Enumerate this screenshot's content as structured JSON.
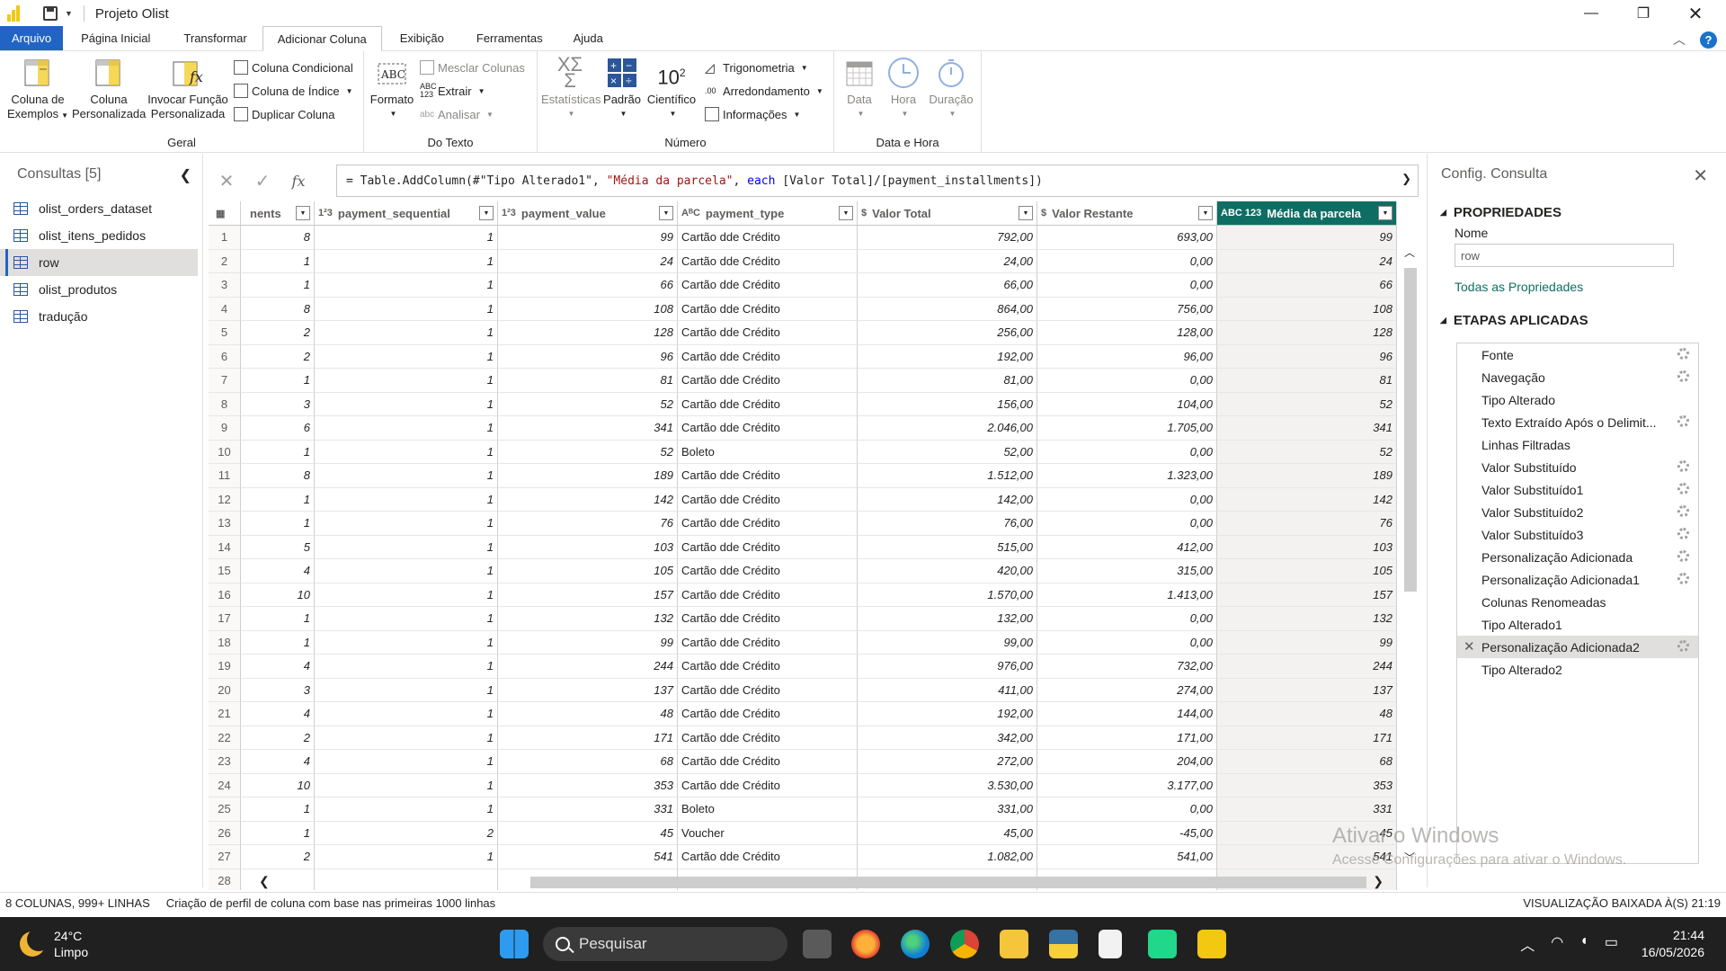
{
  "window": {
    "title": "Projeto Olist"
  },
  "tabs": [
    "Arquivo",
    "Página Inicial",
    "Transformar",
    "Adicionar Coluna",
    "Exibição",
    "Ferramentas",
    "Ajuda"
  ],
  "ribbon": {
    "geral": {
      "label": "Geral",
      "coluna_exemplos": [
        "Coluna de",
        "Exemplos"
      ],
      "coluna_personalizada": [
        "Coluna",
        "Personalizada"
      ],
      "invocar_funcao": [
        "Invocar Função",
        "Personalizada"
      ],
      "coluna_condicional": "Coluna Condicional",
      "coluna_indice": "Coluna de Índice",
      "duplicar_coluna": "Duplicar Coluna"
    },
    "texto": {
      "label": "Do Texto",
      "formato": "Formato",
      "mesclar": "Mesclar Colunas",
      "extrair": "Extrair",
      "analisar": "Analisar"
    },
    "numero": {
      "label": "Número",
      "estatisticas": "Estatísticas",
      "padrao": "Padrão",
      "cientifico": "Científico",
      "trigonometria": "Trigonometria",
      "arredondamento": "Arredondamento",
      "informacoes": "Informações"
    },
    "datahora": {
      "label": "Data e Hora",
      "data": "Data",
      "hora": "Hora",
      "duracao": "Duração"
    }
  },
  "queries": {
    "title": "Consultas [5]",
    "items": [
      "olist_orders_dataset",
      "olist_itens_pedidos",
      "row",
      "olist_produtos",
      "tradução"
    ],
    "selected": "row"
  },
  "formula": {
    "prefix": "= Table.AddColumn(#\"Tipo Alterado1\", ",
    "str": "\"Média da parcela\"",
    "mid": ", ",
    "kw": "each",
    "suffix": " [Valor Total]/[payment_installments])"
  },
  "grid": {
    "columns": [
      {
        "name": "nents",
        "type": ""
      },
      {
        "name": "payment_sequential",
        "type": "1²3"
      },
      {
        "name": "payment_value",
        "type": "1²3"
      },
      {
        "name": "payment_type",
        "type": "AᴮC"
      },
      {
        "name": "Valor Total",
        "type": "$"
      },
      {
        "name": "Valor Restante",
        "type": "$"
      },
      {
        "name": "Média da parcela",
        "type": "ABC 123"
      }
    ],
    "rows": [
      [
        "1",
        "8",
        "1",
        "99",
        "Cartão dde Crédito",
        "792,00",
        "693,00",
        "99"
      ],
      [
        "2",
        "1",
        "1",
        "24",
        "Cartão dde Crédito",
        "24,00",
        "0,00",
        "24"
      ],
      [
        "3",
        "1",
        "1",
        "66",
        "Cartão dde Crédito",
        "66,00",
        "0,00",
        "66"
      ],
      [
        "4",
        "8",
        "1",
        "108",
        "Cartão dde Crédito",
        "864,00",
        "756,00",
        "108"
      ],
      [
        "5",
        "2",
        "1",
        "128",
        "Cartão dde Crédito",
        "256,00",
        "128,00",
        "128"
      ],
      [
        "6",
        "2",
        "1",
        "96",
        "Cartão dde Crédito",
        "192,00",
        "96,00",
        "96"
      ],
      [
        "7",
        "1",
        "1",
        "81",
        "Cartão dde Crédito",
        "81,00",
        "0,00",
        "81"
      ],
      [
        "8",
        "3",
        "1",
        "52",
        "Cartão dde Crédito",
        "156,00",
        "104,00",
        "52"
      ],
      [
        "9",
        "6",
        "1",
        "341",
        "Cartão dde Crédito",
        "2.046,00",
        "1.705,00",
        "341"
      ],
      [
        "10",
        "1",
        "1",
        "52",
        "Boleto",
        "52,00",
        "0,00",
        "52"
      ],
      [
        "11",
        "8",
        "1",
        "189",
        "Cartão dde Crédito",
        "1.512,00",
        "1.323,00",
        "189"
      ],
      [
        "12",
        "1",
        "1",
        "142",
        "Cartão dde Crédito",
        "142,00",
        "0,00",
        "142"
      ],
      [
        "13",
        "1",
        "1",
        "76",
        "Cartão dde Crédito",
        "76,00",
        "0,00",
        "76"
      ],
      [
        "14",
        "5",
        "1",
        "103",
        "Cartão dde Crédito",
        "515,00",
        "412,00",
        "103"
      ],
      [
        "15",
        "4",
        "1",
        "105",
        "Cartão dde Crédito",
        "420,00",
        "315,00",
        "105"
      ],
      [
        "16",
        "10",
        "1",
        "157",
        "Cartão dde Crédito",
        "1.570,00",
        "1.413,00",
        "157"
      ],
      [
        "17",
        "1",
        "1",
        "132",
        "Cartão dde Crédito",
        "132,00",
        "0,00",
        "132"
      ],
      [
        "18",
        "1",
        "1",
        "99",
        "Cartão dde Crédito",
        "99,00",
        "0,00",
        "99"
      ],
      [
        "19",
        "4",
        "1",
        "244",
        "Cartão dde Crédito",
        "976,00",
        "732,00",
        "244"
      ],
      [
        "20",
        "3",
        "1",
        "137",
        "Cartão dde Crédito",
        "411,00",
        "274,00",
        "137"
      ],
      [
        "21",
        "4",
        "1",
        "48",
        "Cartão dde Crédito",
        "192,00",
        "144,00",
        "48"
      ],
      [
        "22",
        "2",
        "1",
        "171",
        "Cartão dde Crédito",
        "342,00",
        "171,00",
        "171"
      ],
      [
        "23",
        "4",
        "1",
        "68",
        "Cartão dde Crédito",
        "272,00",
        "204,00",
        "68"
      ],
      [
        "24",
        "10",
        "1",
        "353",
        "Cartão dde Crédito",
        "3.530,00",
        "3.177,00",
        "353"
      ],
      [
        "25",
        "1",
        "1",
        "331",
        "Boleto",
        "331,00",
        "0,00",
        "331"
      ],
      [
        "26",
        "1",
        "2",
        "45",
        "Voucher",
        "45,00",
        "-45,00",
        "45"
      ],
      [
        "27",
        "2",
        "1",
        "541",
        "Cartão dde Crédito",
        "1.082,00",
        "541,00",
        "541"
      ],
      [
        "28",
        "",
        "",
        "",
        "",
        "",
        "",
        ""
      ]
    ]
  },
  "settings": {
    "title": "Config. Consulta",
    "properties": "PROPRIEDADES",
    "name_label": "Nome",
    "name_value": "row",
    "all_props": "Todas as Propriedades",
    "steps_title": "ETAPAS APLICADAS",
    "steps": [
      {
        "label": "Fonte",
        "gear": true
      },
      {
        "label": "Navegação",
        "gear": true
      },
      {
        "label": "Tipo Alterado",
        "gear": false
      },
      {
        "label": "Texto Extraído Após o Delimit...",
        "gear": true
      },
      {
        "label": "Linhas Filtradas",
        "gear": false
      },
      {
        "label": "Valor Substituído",
        "gear": true
      },
      {
        "label": "Valor Substituído1",
        "gear": true
      },
      {
        "label": "Valor Substituído2",
        "gear": true
      },
      {
        "label": "Valor Substituído3",
        "gear": true
      },
      {
        "label": "Personalização Adicionada",
        "gear": true
      },
      {
        "label": "Personalização Adicionada1",
        "gear": true
      },
      {
        "label": "Colunas Renomeadas",
        "gear": false
      },
      {
        "label": "Tipo Alterado1",
        "gear": false
      },
      {
        "label": "Personalização Adicionada2",
        "gear": true,
        "selected": true
      },
      {
        "label": "Tipo Alterado2",
        "gear": false
      }
    ]
  },
  "status": {
    "left1": "8 COLUNAS, 999+ LINHAS",
    "left2": "Criação de perfil de coluna com base nas primeiras 1000 linhas",
    "right": "VISUALIZAÇÃO BAIXADA À(S) 21:19"
  },
  "watermark": {
    "line1": "Ativar o Windows",
    "line2": "Acesse Configurações para ativar o Windows."
  },
  "taskbar": {
    "temp": "24°C",
    "weather": "Limpo",
    "search": "Pesquisar",
    "time": "21:44",
    "date": "16/05/2026"
  },
  "colors": {
    "accent": "#2264c4",
    "selected_column": "#0f6e64",
    "powerbi_yellow": "#f2c811"
  }
}
